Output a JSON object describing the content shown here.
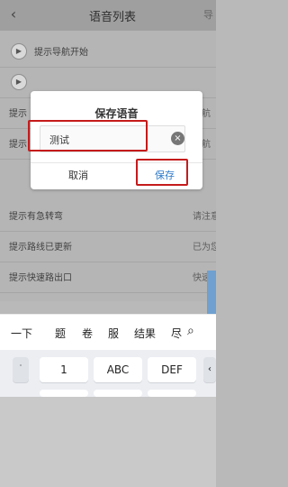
{
  "header": {
    "back_icon": "chevron-left-icon",
    "title": "语音列表"
  },
  "list": {
    "rows": [
      {
        "label": "提示导航开始",
        "right": ""
      },
      {
        "label": "",
        "right": ""
      },
      {
        "label": "提示",
        "right": "导航"
      },
      {
        "label": "提示",
        "right": "导航"
      },
      {
        "label": "提示有急转弯",
        "right": "请注意"
      },
      {
        "label": "提示路线已更新",
        "right": "已为您"
      },
      {
        "label": "提示快速路出口",
        "right": "快速"
      }
    ]
  },
  "dialog": {
    "title": "保存语音",
    "input_value": "测试",
    "clear_icon": "clear-circle-icon",
    "cancel_label": "取消",
    "save_label": "保存"
  },
  "keyboard": {
    "suggestions": [
      "一下",
      "题",
      "卷",
      "服",
      "结果",
      "尽"
    ],
    "search_icon": "search-icon",
    "keys": [
      "1",
      "ABC",
      "DEF"
    ]
  },
  "colors": {
    "highlight": "#c51b1b",
    "save_text": "#2d79c8",
    "overlay": "#b5b5b5"
  }
}
